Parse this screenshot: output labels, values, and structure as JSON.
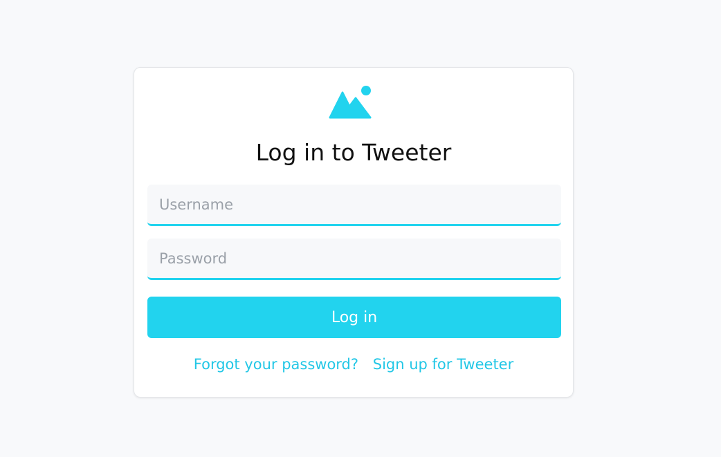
{
  "page": {
    "background": "#f8f9fb",
    "accent_color": "#22d3ee"
  },
  "logo": {
    "icon": "mountain-sun-icon"
  },
  "login": {
    "title": "Log in to Tweeter",
    "username_placeholder": "Username",
    "password_placeholder": "Password",
    "submit_label": "Log in",
    "forgot_password_label": "Forgot your password?",
    "signup_label": "Sign up for Tweeter"
  }
}
